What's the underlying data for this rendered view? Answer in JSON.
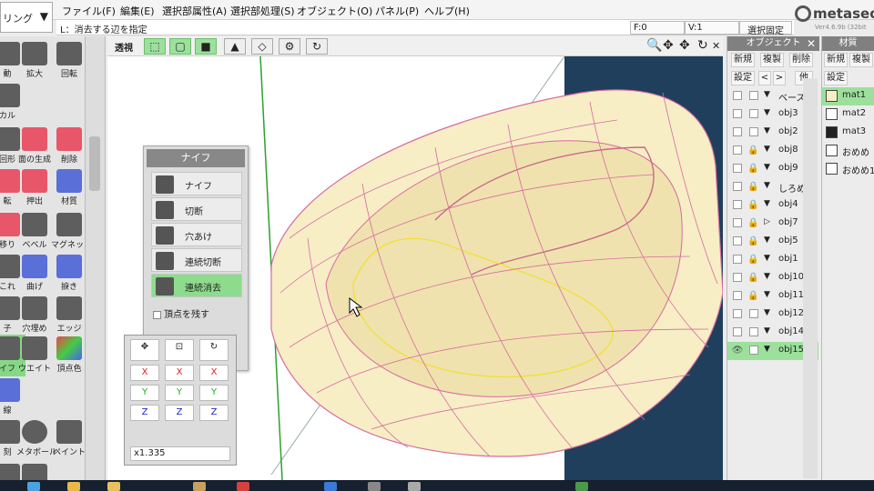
{
  "menubar": {
    "mode_label": "リング",
    "items": [
      "ファイル(F)",
      "編集(E)",
      "選択部属性(A)",
      "選択部処理(S)",
      "オブジェクト(O)",
      "パネル(P)",
      "ヘルプ(H)"
    ]
  },
  "logo": {
    "name": "metasequ",
    "version": "Ver4.6.9b (32bit"
  },
  "status": {
    "hint": "L：消去する辺を指定",
    "f_label": "F:0",
    "v_label": "V:1",
    "select_fixed": "選択固定"
  },
  "toolbox": {
    "tools": [
      "動",
      "拡大",
      "回転",
      "カル",
      "回形",
      "面の生成",
      "削除",
      "転",
      "押出",
      "材質",
      "移り",
      "ベベル",
      "マグネット",
      "これ",
      "曲げ",
      "捩き",
      "子",
      "穴埋め",
      "エッジ",
      "イフ",
      "ウエイト",
      "頂点色",
      "線",
      "刻",
      "メタボール",
      "ペイント"
    ]
  },
  "viewbar": {
    "perspective": "透視"
  },
  "knife": {
    "title": "ナイフ",
    "buttons": [
      "ナイフ",
      "切断",
      "穴あけ",
      "連続切断",
      "連続消去"
    ],
    "keep_vertex": "頂点を残す"
  },
  "xyz": {
    "x": "X",
    "y": "Y",
    "z": "Z",
    "scale": "x1.335"
  },
  "objects": {
    "title": "オブジェクト",
    "btn_new": "新規",
    "btn_copy": "複製",
    "btn_delete": "削除",
    "btn_settings": "設定",
    "btn_up": "<",
    "btn_down": ">",
    "btn_other": "他",
    "items": [
      "ベース",
      "obj3",
      "obj2",
      "obj8",
      "obj9",
      "しろめ",
      "obj4",
      "obj7",
      "obj5",
      "obj1",
      "obj10",
      "obj11",
      "obj12",
      "obj14",
      "obj15"
    ]
  },
  "materials": {
    "title": "材質",
    "btn_new": "新規",
    "btn_copy": "複製",
    "btn_settings": "設定",
    "items": [
      {
        "name": "mat1",
        "color": "#f6efc1"
      },
      {
        "name": "mat2",
        "color": "#ffffff"
      },
      {
        "name": "mat3",
        "color": "#222222"
      },
      {
        "name": "おめめ",
        "color": "#ffffff"
      },
      {
        "name": "おめめ1",
        "color": "#ffffff"
      }
    ]
  },
  "colors": {
    "accent": "#8ddc8d",
    "mesh_fill": "#f7eec6",
    "mesh_edge": "#d86aa0",
    "select_edge": "#f0e030",
    "axis_green": "#2ea02e",
    "bg_blue": "#1f3f5c"
  }
}
